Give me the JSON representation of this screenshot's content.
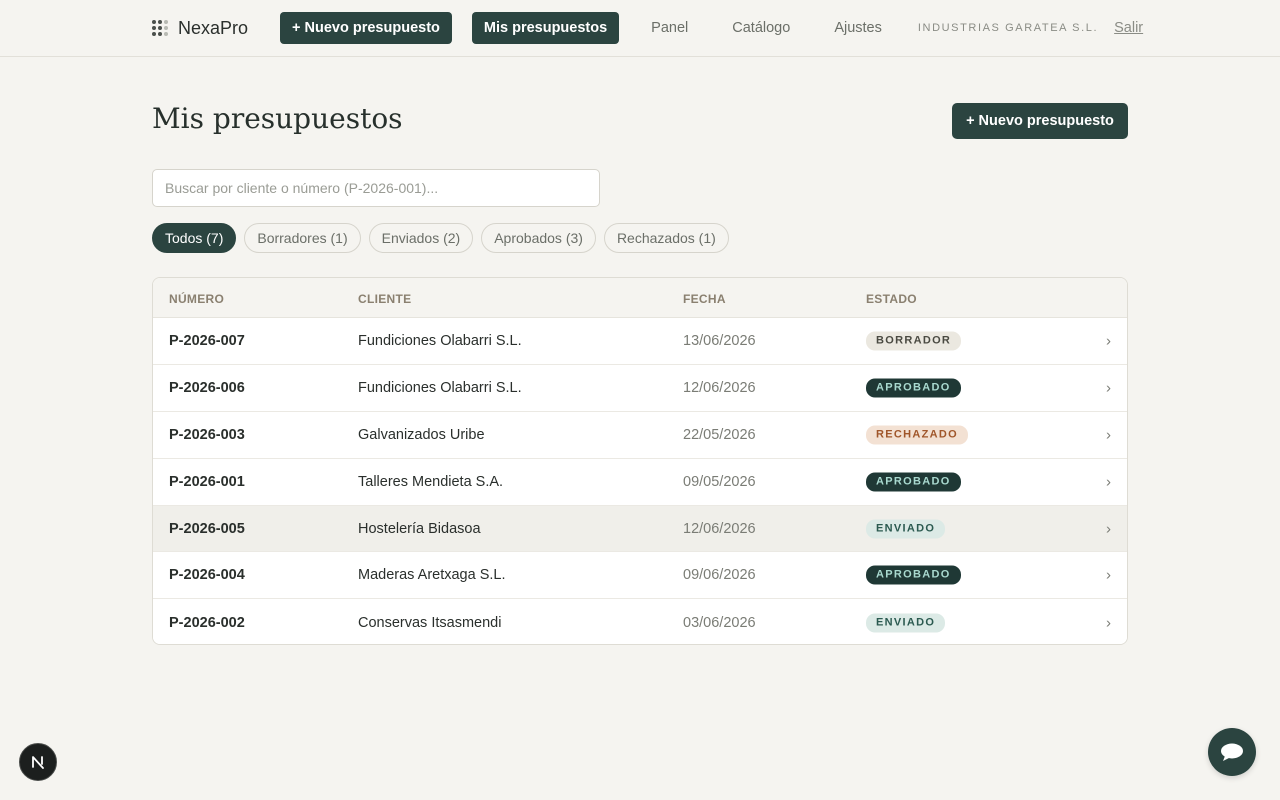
{
  "brand": {
    "name": "NexaPro"
  },
  "nav": {
    "new_quote": "+ Nuevo presupuesto",
    "my_quotes": "Mis presupuestos",
    "panel": "Panel",
    "catalog": "Catálogo",
    "settings": "Ajustes",
    "company": "INDUSTRIAS GARATEA S.L.",
    "logout": "Salir"
  },
  "page": {
    "title": "Mis presupuestos",
    "new_button": "+ Nuevo presupuesto",
    "search_placeholder": "Buscar por cliente o número (P-2026-001)..."
  },
  "filters": [
    {
      "label": "Todos (7)",
      "active": true
    },
    {
      "label": "Borradores (1)",
      "active": false
    },
    {
      "label": "Enviados (2)",
      "active": false
    },
    {
      "label": "Aprobados (3)",
      "active": false
    },
    {
      "label": "Rechazados (1)",
      "active": false
    }
  ],
  "table": {
    "headers": {
      "number": "NÚMERO",
      "client": "CLIENTE",
      "date": "FECHA",
      "status": "ESTADO"
    },
    "rows": [
      {
        "number": "P-2026-007",
        "client": "Fundiciones Olabarri S.L.",
        "date": "13/06/2026",
        "status": "BORRADOR",
        "kind": "draft",
        "arrow": "›"
      },
      {
        "number": "P-2026-006",
        "client": "Fundiciones Olabarri S.L.",
        "date": "12/06/2026",
        "status": "APROBADO",
        "kind": "approved",
        "arrow": "›"
      },
      {
        "number": "P-2026-003",
        "client": "Galvanizados Uribe",
        "date": "22/05/2026",
        "status": "RECHAZADO",
        "kind": "rejected",
        "arrow": "›"
      },
      {
        "number": "P-2026-001",
        "client": "Talleres Mendieta S.A.",
        "date": "09/05/2026",
        "status": "APROBADO",
        "kind": "approved",
        "arrow": "›"
      },
      {
        "number": "P-2026-005",
        "client": "Hostelería Bidasoa",
        "date": "12/06/2026",
        "status": "ENVIADO",
        "kind": "sent",
        "arrow": "›",
        "hover": true
      },
      {
        "number": "P-2026-004",
        "client": "Maderas Aretxaga S.L.",
        "date": "09/06/2026",
        "status": "APROBADO",
        "kind": "approved",
        "arrow": "›"
      },
      {
        "number": "P-2026-002",
        "client": "Conservas Itsasmendi",
        "date": "03/06/2026",
        "status": "ENVIADO",
        "kind": "sent",
        "arrow": "›"
      }
    ]
  },
  "colors": {
    "primary": "#2b4440",
    "background": "#f5f4f0",
    "badge_draft": "#ebe8e0",
    "badge_approved": "#1f3835",
    "badge_rejected": "#f3e1d3",
    "badge_sent": "#dceae6"
  },
  "icons": {
    "brand": "grid-dots-icon",
    "row_chevron": "chevron-right-icon",
    "dev_badge": "n-logo-icon",
    "chat": "chat-bubble-icon"
  }
}
